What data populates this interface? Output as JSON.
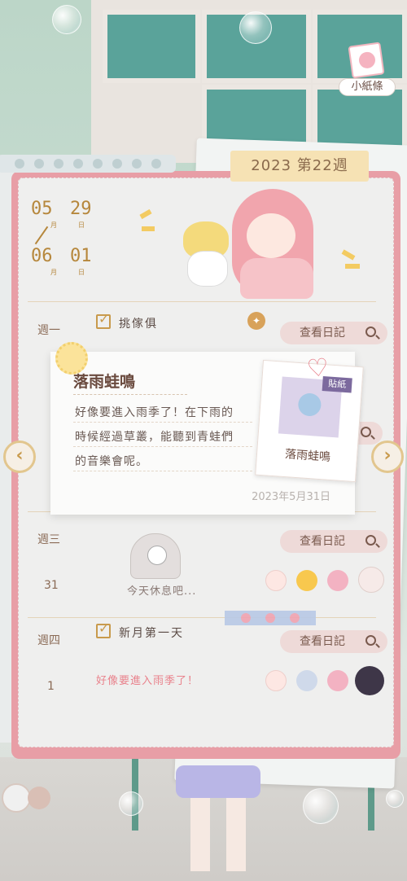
{
  "note_button": {
    "label": "小紙條"
  },
  "week_tab": "2023 第22週",
  "date_range": {
    "start_month": "05",
    "start_day": "29",
    "end_month": "06",
    "end_day": "01",
    "month_unit": "月",
    "day_unit": "日"
  },
  "view_label": "查看日記",
  "days": [
    {
      "label": "週一",
      "task": "挑傢俱"
    },
    {
      "label": "週三",
      "num": "31",
      "rest": "今天休息吧..."
    },
    {
      "label": "週四",
      "num": "1",
      "task": "新月第一天",
      "note": "好像要進入雨季了！"
    }
  ],
  "popup": {
    "title": "落雨蛙鳴",
    "lines": [
      "好像要進入雨季了！在下雨的",
      "時候經過草叢，能聽到青蛙們",
      "的音樂會呢。"
    ],
    "date": "2023年5月31日",
    "sticker_badge": "貼紙",
    "sticker_name": "落雨蛙鳴"
  },
  "arrows": {
    "left": "‹",
    "right": "›"
  },
  "colors": {
    "book_border": "#e89ea6",
    "accent_gold": "#b6873c",
    "button_bg": "#eedad8"
  }
}
